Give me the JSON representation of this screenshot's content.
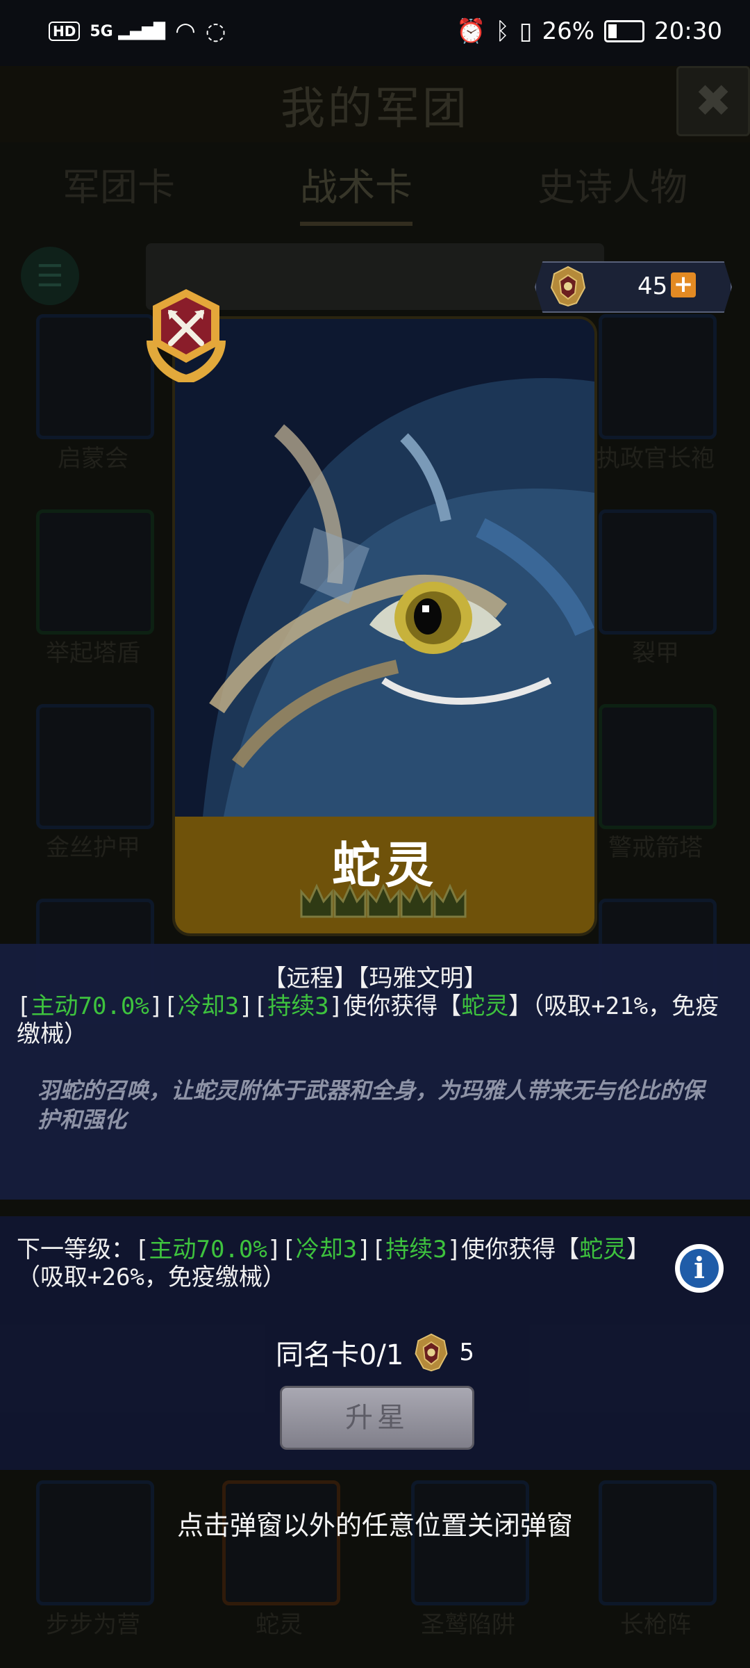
{
  "status_bar": {
    "network_badge": "HD",
    "signal": "5G",
    "battery": "26%",
    "time": "20:30"
  },
  "background": {
    "title": "我的军团",
    "tabs": [
      "军团卡",
      "战术卡",
      "史诗人物"
    ],
    "active_tab": "战术卡",
    "cards_left": [
      "启蒙会",
      "举起塔盾",
      "金丝护甲",
      "",
      "",
      "",
      "步步为营"
    ],
    "cards_right": [
      "执政官长袍",
      "裂甲",
      "警戒箭塔",
      "",
      "",
      "",
      "长枪阵"
    ],
    "bottom_row": [
      "步步为营",
      "蛇灵",
      "圣鹫陷阱",
      "长枪阵"
    ]
  },
  "currency": {
    "amount": "45",
    "plus": "+"
  },
  "card": {
    "name": "蛇灵",
    "crown_count": 5
  },
  "description": {
    "tags": "【远程】【玛雅文明】",
    "effect": {
      "b1": "[",
      "active": "主动70.0%",
      "b2": "][",
      "cooldown": "冷却3",
      "b3": "][",
      "duration": "持续3",
      "mid": "]使你获得【",
      "buff": "蛇灵",
      "tail": "】（吸取+21%，免疫缴械）"
    },
    "flavor": "羽蛇的召唤，让蛇灵附体于武器和全身，为玛雅人带来无与伦比的保护和强化"
  },
  "next_level": {
    "prefix": "下一等级：[",
    "active": "主动70.0%",
    "b2": "][",
    "cooldown": "冷却3",
    "b3": "][",
    "duration": "持续3",
    "mid": "]使你获得【",
    "buff": "蛇灵",
    "tail": "】（吸取+26%，免疫缴械）"
  },
  "duplicates": {
    "label": "同名卡0/1",
    "cost": "5"
  },
  "upgrade_button": "升星",
  "dismiss_hint": "点击弹窗以外的任意位置关闭弹窗"
}
